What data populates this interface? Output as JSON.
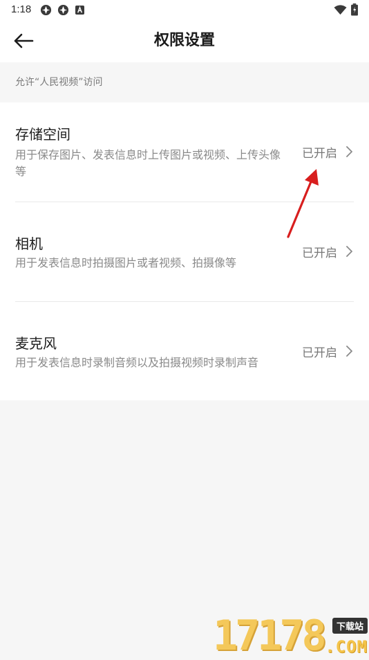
{
  "status_bar": {
    "time": "1:18",
    "icons": [
      "app-notification-icon",
      "app-notification-icon",
      "a-notification-icon",
      "wifi-icon",
      "battery-icon"
    ]
  },
  "header": {
    "back_icon": "arrow-left-icon",
    "title": "权限设置"
  },
  "section": {
    "caption": "允许“人民视频”访问"
  },
  "permissions": [
    {
      "title": "存储空间",
      "description": "用于保存图片、发表信息时上传图片或视频、上传头像等",
      "status": "已开启"
    },
    {
      "title": "相机",
      "description": "用于发表信息时拍摄图片或者视频、拍摄像等",
      "status": "已开启"
    },
    {
      "title": "麦克风",
      "description": "用于发表信息时录制音频以及拍摄视频时录制声音",
      "status": "已开启"
    }
  ],
  "watermark": {
    "digits": "17178",
    "tag": "下载站",
    "domain": ".COM"
  },
  "colors": {
    "background": "#f6f6f6",
    "card": "#ffffff",
    "annotation": "#d81e1e",
    "watermark": "#f4c44a"
  }
}
